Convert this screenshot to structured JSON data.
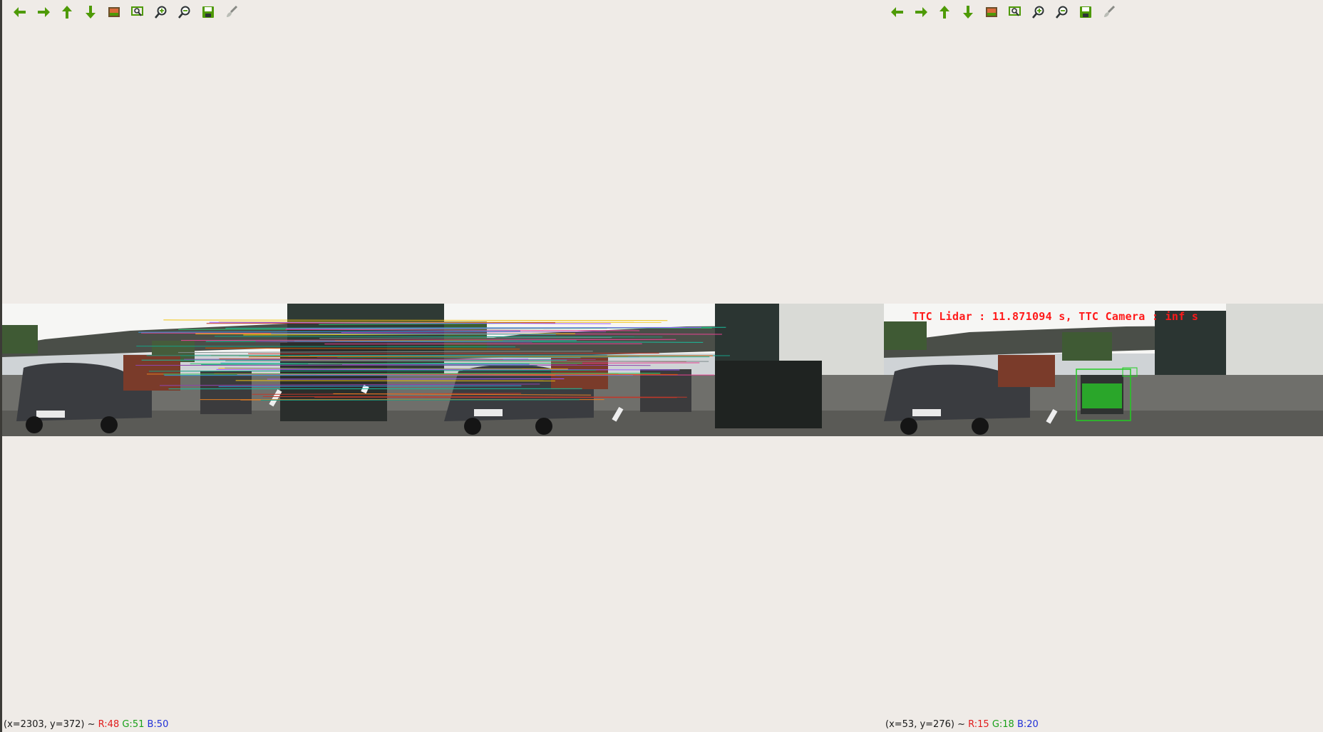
{
  "left_window": {
    "toolbar": [
      "arrow-left-icon",
      "arrow-right-icon",
      "arrow-up-icon",
      "arrow-down-icon",
      "image-icon",
      "zoom-region-icon",
      "zoom-in-icon",
      "zoom-out-icon",
      "save-icon",
      "brush-icon"
    ],
    "status": {
      "coords": "(x=2303, y=372) ~",
      "r": "R:48",
      "g": "G:51",
      "b": "B:50"
    }
  },
  "right_window": {
    "toolbar": [
      "arrow-left-icon",
      "arrow-right-icon",
      "arrow-up-icon",
      "arrow-down-icon",
      "image-icon",
      "zoom-region-icon",
      "zoom-in-icon",
      "zoom-out-icon",
      "save-icon",
      "brush-icon"
    ],
    "overlay_text": "TTC Lidar : 11.871094 s, TTC Camera : inf s",
    "status": {
      "coords": "(x=53, y=276) ~",
      "r": "R:15",
      "g": "G:18",
      "b": "B:20"
    }
  },
  "colors": {
    "background": "#efebe7",
    "toolbar_icon": "#4e9a06",
    "overlay_text": "#ff1a1a",
    "bbox": "#22cc22"
  }
}
